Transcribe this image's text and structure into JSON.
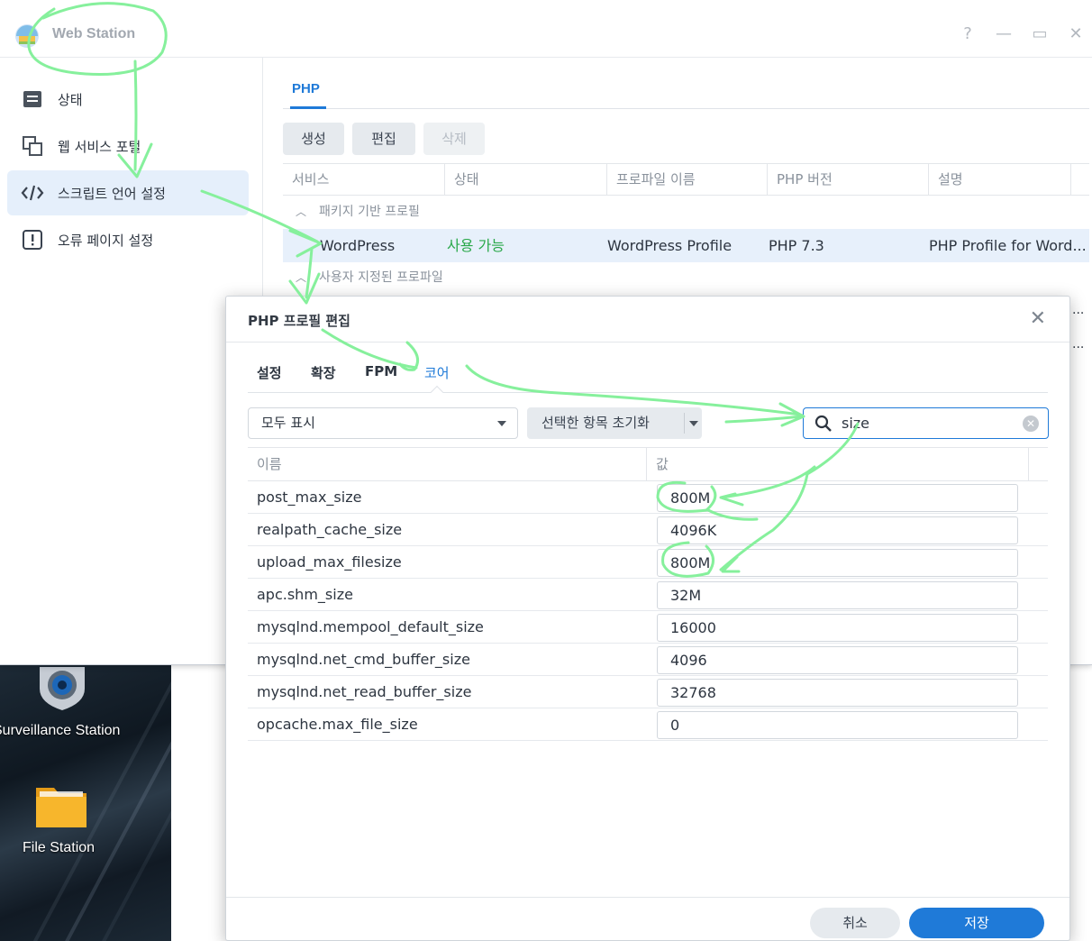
{
  "app": {
    "title": "Web Station"
  },
  "window_controls": {
    "help": "?",
    "minimize": "—",
    "maximize": "▭",
    "close": "✕"
  },
  "sidebar": {
    "items": [
      {
        "label": "상태",
        "icon": "status-icon"
      },
      {
        "label": "웹 서비스 포털",
        "icon": "portal-icon"
      },
      {
        "label": "스크립트 언어 설정",
        "icon": "code-icon",
        "active": true
      },
      {
        "label": "오류 페이지 설정",
        "icon": "error-page-icon"
      }
    ]
  },
  "main": {
    "tab": "PHP",
    "buttons": {
      "create": "생성",
      "edit": "편집",
      "delete": "삭제"
    },
    "columns": [
      "서비스",
      "상태",
      "프로파일 이름",
      "PHP 버전",
      "설명"
    ],
    "groups": {
      "package": "패키지 기반 프로필",
      "custom": "사용자 지정된 프로파일"
    },
    "row": {
      "service": "WordPress",
      "status": "사용 가능",
      "profile": "WordPress Profile",
      "php_version": "PHP 7.3",
      "description": "PHP Profile for Word..."
    },
    "partial_cells": [
      "...",
      "..."
    ]
  },
  "dialog": {
    "title": "PHP 프로필 편집",
    "close": "✕",
    "tabs": [
      "설정",
      "확장",
      "FPM",
      "코어"
    ],
    "active_tab": "코어",
    "filter_select": "모두 표시",
    "reset_button": "선택한 항목 초기화",
    "search_value": "size",
    "columns": {
      "name": "이름",
      "value": "값"
    },
    "rows": [
      {
        "name": "post_max_size",
        "value": "800M"
      },
      {
        "name": "realpath_cache_size",
        "value": "4096K"
      },
      {
        "name": "upload_max_filesize",
        "value": "800M"
      },
      {
        "name": "apc.shm_size",
        "value": "32M"
      },
      {
        "name": "mysqlnd.mempool_default_size",
        "value": "16000"
      },
      {
        "name": "mysqlnd.net_cmd_buffer_size",
        "value": "4096"
      },
      {
        "name": "mysqlnd.net_read_buffer_size",
        "value": "32768"
      },
      {
        "name": "opcache.max_file_size",
        "value": "0"
      }
    ],
    "cancel": "취소",
    "save": "저장"
  },
  "desktop": {
    "icons": [
      {
        "label": "Surveillance Station",
        "icon": "surveillance-icon"
      },
      {
        "label": "File Station",
        "icon": "folder-icon"
      }
    ]
  },
  "colors": {
    "accent": "#1f7ad8",
    "status_ok": "#2aa84a",
    "annotation": "#86f09c"
  }
}
